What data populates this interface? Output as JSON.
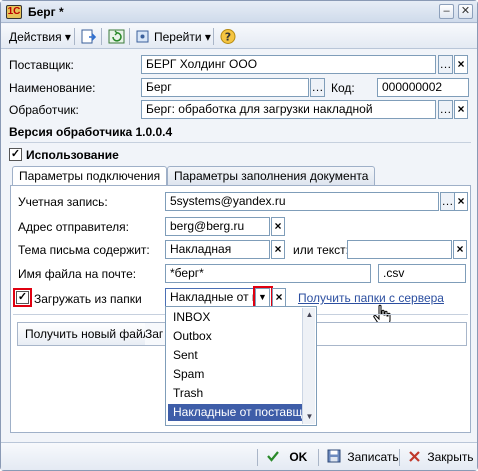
{
  "window": {
    "title": "Берг *"
  },
  "toolbar": {
    "actions_label": "Действия",
    "goto_label": "Перейти"
  },
  "header": {
    "supplier_label": "Поставщик:",
    "supplier_value": "БЕРГ Холдинг ООО",
    "name_label": "Наименование:",
    "name_value": "Берг",
    "code_label": "Код:",
    "code_value": "000000002",
    "handler_label": "Обработчик:",
    "handler_value": "Берг: обработка для загрузки накладной",
    "version_text": "Версия обработчика 1.0.0.4",
    "usage_label": "Использование"
  },
  "tabs": [
    {
      "label": "Параметры подключения"
    },
    {
      "label": "Параметры заполнения документа"
    }
  ],
  "connection": {
    "account_label": "Учетная запись:",
    "account_value": "5systems@yandex.ru",
    "sender_label": "Адрес отправителя:",
    "sender_value": "berg@berg.ru",
    "subject_label": "Тема письма содержит:",
    "subject_value": "Накладная",
    "or_text_label": "или текст:",
    "or_text_value": "",
    "filename_label": "Имя файла на почте:",
    "filename_value": "*берг*",
    "ext_value": ".csv",
    "load_folder_label": "Загружать из папки",
    "folder_value": "Накладные от поставщ...",
    "get_folders_link": "Получить папки с сервера",
    "get_new_file_button": "Получить новый файл",
    "partial_button": "Заг"
  },
  "folder_dropdown": {
    "options": [
      "INBOX",
      "Outbox",
      "Sent",
      "Spam",
      "Trash",
      "Накладные от поставщ..."
    ],
    "selected": "Накладные от поставщ..."
  },
  "footer": {
    "ok_label": "OK",
    "save_label": "Записать",
    "close_label": "Закрыть"
  },
  "colors": {
    "accent_highlight": "#e00010",
    "selection": "#3e5da8",
    "link": "#2c4fa0"
  }
}
